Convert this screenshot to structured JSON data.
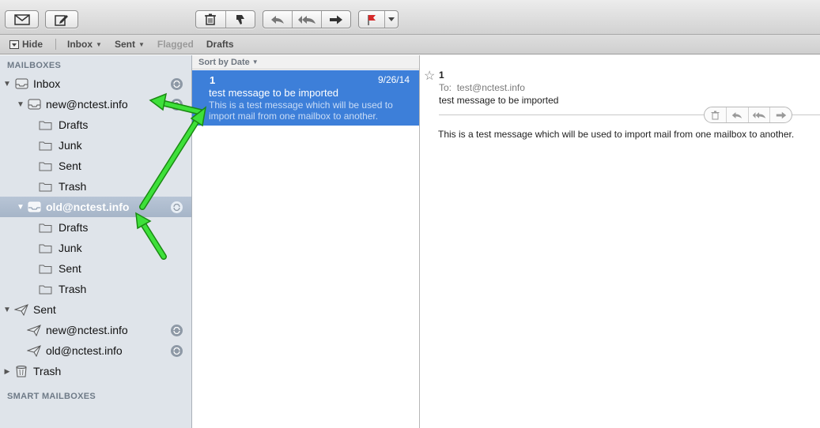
{
  "favorites": {
    "hide": "Hide",
    "inbox": "Inbox",
    "sent": "Sent",
    "flagged": "Flagged",
    "drafts": "Drafts"
  },
  "sidebar": {
    "mailboxes_header": "MAILBOXES",
    "smart_header": "SMART MAILBOXES",
    "inbox": "Inbox",
    "inbox_new": "new@nctest.info",
    "inbox_new_drafts": "Drafts",
    "inbox_new_junk": "Junk",
    "inbox_new_sent": "Sent",
    "inbox_new_trash": "Trash",
    "inbox_old": "old@nctest.info",
    "inbox_old_drafts": "Drafts",
    "inbox_old_junk": "Junk",
    "inbox_old_sent": "Sent",
    "inbox_old_trash": "Trash",
    "sent": "Sent",
    "sent_new": "new@nctest.info",
    "sent_old": "old@nctest.info",
    "trash": "Trash"
  },
  "message_list": {
    "sort_label": "Sort by Date",
    "messages": [
      {
        "from": "1",
        "date": "9/26/14",
        "subject": "test message to be imported",
        "preview": "This is a test message which will be used to import mail from one mailbox to another."
      }
    ]
  },
  "reader": {
    "from": "1",
    "to_label": "To:",
    "to": "test@nctest.info",
    "subject": "test message to be imported",
    "body": "This is a test message which will be used to import mail from one mailbox to another."
  },
  "colors": {
    "selection": "#3d7fd9",
    "sidebar_bg": "#dfe4ea",
    "annotation_arrow": "#3ee03a",
    "flag": "#d62a2a"
  }
}
